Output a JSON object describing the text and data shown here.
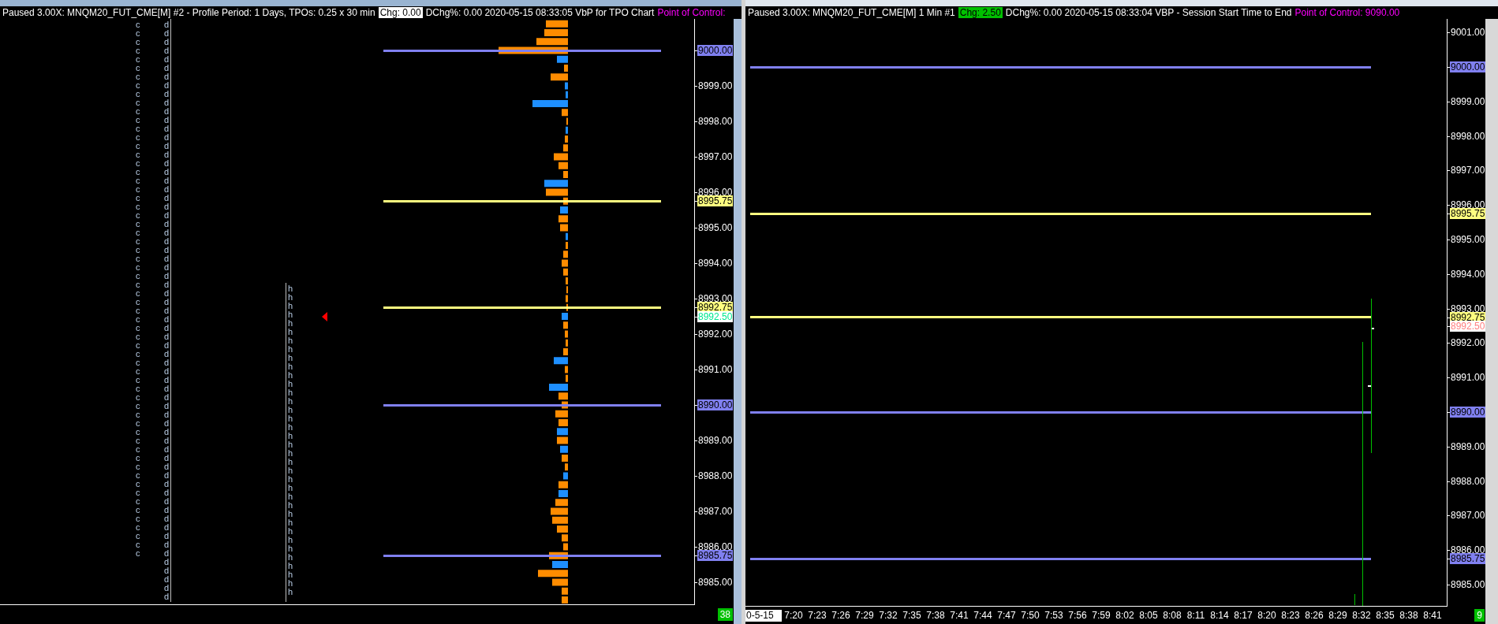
{
  "left_chart": {
    "header": [
      {
        "text": "Paused 3.00X: MNQM20_FUT_CME[M]  #2 - Profile Period: 1 Days, TPOs: 0.25 x 30 min",
        "kind": "plain"
      },
      {
        "text": "Chg: 0.00",
        "kind": "badge",
        "color": "#ffffff"
      },
      {
        "text": "DChg%: 0.00 2020-05-15 08:33:05 VbP for TPO Chart",
        "kind": "plain"
      },
      {
        "text": "Point of Control:",
        "kind": "accent",
        "color": "#ff00ff"
      }
    ],
    "tpo_columns": [
      {
        "letters": "cccccccccccccccccccccccccccccccccccccccccccccccccccccccccccccc"
      },
      {
        "letters": "ddddddddddddddddddddddddddddddddddddddddddddddddddddddddddddddddddd"
      },
      {
        "letters": "hhhhhhhhhhhhhhhhhhhhhhhhhhhhhhhhhhhh"
      }
    ],
    "price_axis": [
      {
        "text": "9000.00",
        "kind": "level",
        "color": "#8080f0"
      },
      {
        "text": "8999.00",
        "kind": "tick"
      },
      {
        "text": "8998.00",
        "kind": "tick"
      },
      {
        "text": "8997.00",
        "kind": "tick"
      },
      {
        "text": "8996.00",
        "kind": "tick"
      },
      {
        "text": "8995.75",
        "kind": "level",
        "color": "#ffff80"
      },
      {
        "text": "8995.00",
        "kind": "tick"
      },
      {
        "text": "8994.00",
        "kind": "tick"
      },
      {
        "text": "8993.00",
        "kind": "tick"
      },
      {
        "text": "8992.75",
        "kind": "level",
        "color": "#ffff80"
      },
      {
        "text": "8992.50",
        "kind": "price",
        "color": "#00e890"
      },
      {
        "text": "8992.00",
        "kind": "tick"
      },
      {
        "text": "8991.00",
        "kind": "tick"
      },
      {
        "text": "8990.00",
        "kind": "level",
        "color": "#8080f0"
      },
      {
        "text": "8989.00",
        "kind": "tick"
      },
      {
        "text": "8988.00",
        "kind": "tick"
      },
      {
        "text": "8987.00",
        "kind": "tick"
      },
      {
        "text": "8986.00",
        "kind": "tick"
      },
      {
        "text": "8985.75",
        "kind": "level",
        "color": "#8080f0"
      },
      {
        "text": "8985.00",
        "kind": "tick"
      }
    ],
    "footer_badge": "38"
  },
  "right_chart": {
    "header": [
      {
        "text": "Paused 3.00X: MNQM20_FUT_CME[M]  1 Min  #1",
        "kind": "plain"
      },
      {
        "text": "Chg: 2.50",
        "kind": "badge",
        "color": "#00c000"
      },
      {
        "text": "DChg%: 0.00 2020-05-15 08:33:04 VBP - Session Start Time to End",
        "kind": "plain"
      },
      {
        "text": "Point of Control: 9090.00",
        "kind": "accent",
        "color": "#ff00ff"
      }
    ],
    "price_axis": [
      {
        "text": "9001.00",
        "kind": "tick"
      },
      {
        "text": "9000.00",
        "kind": "level",
        "color": "#8080f0"
      },
      {
        "text": "8999.00",
        "kind": "tick"
      },
      {
        "text": "8998.00",
        "kind": "tick"
      },
      {
        "text": "8997.00",
        "kind": "tick"
      },
      {
        "text": "8996.00",
        "kind": "tick"
      },
      {
        "text": "8995.75",
        "kind": "level",
        "color": "#ffff80"
      },
      {
        "text": "8995.00",
        "kind": "tick"
      },
      {
        "text": "8994.00",
        "kind": "tick"
      },
      {
        "text": "8993.00",
        "kind": "tick"
      },
      {
        "text": "8992.75",
        "kind": "level",
        "color": "#ffff80"
      },
      {
        "text": "8992.50",
        "kind": "price",
        "color": "#ff8080"
      },
      {
        "text": "8992.00",
        "kind": "tick"
      },
      {
        "text": "8991.00",
        "kind": "tick"
      },
      {
        "text": "8990.00",
        "kind": "level",
        "color": "#8080f0"
      },
      {
        "text": "8989.00",
        "kind": "tick"
      },
      {
        "text": "8988.00",
        "kind": "tick"
      },
      {
        "text": "8987.00",
        "kind": "tick"
      },
      {
        "text": "8986.00",
        "kind": "tick"
      },
      {
        "text": "8985.75",
        "kind": "level",
        "color": "#8080f0"
      },
      {
        "text": "8985.00",
        "kind": "tick"
      }
    ],
    "time_axis": {
      "date": "0-5-15",
      "times": [
        "7:20",
        "7:23",
        "7:26",
        "7:29",
        "7:32",
        "7:35",
        "7:38",
        "7:41",
        "7:44",
        "7:47",
        "7:50",
        "7:53",
        "7:56",
        "7:59",
        "8:02",
        "8:05",
        "8:08",
        "8:11",
        "8:14",
        "8:17",
        "8:20",
        "8:23",
        "8:26",
        "8:29",
        "8:32",
        "8:35",
        "8:38",
        "8:41"
      ]
    },
    "footer_badge": "9"
  }
}
